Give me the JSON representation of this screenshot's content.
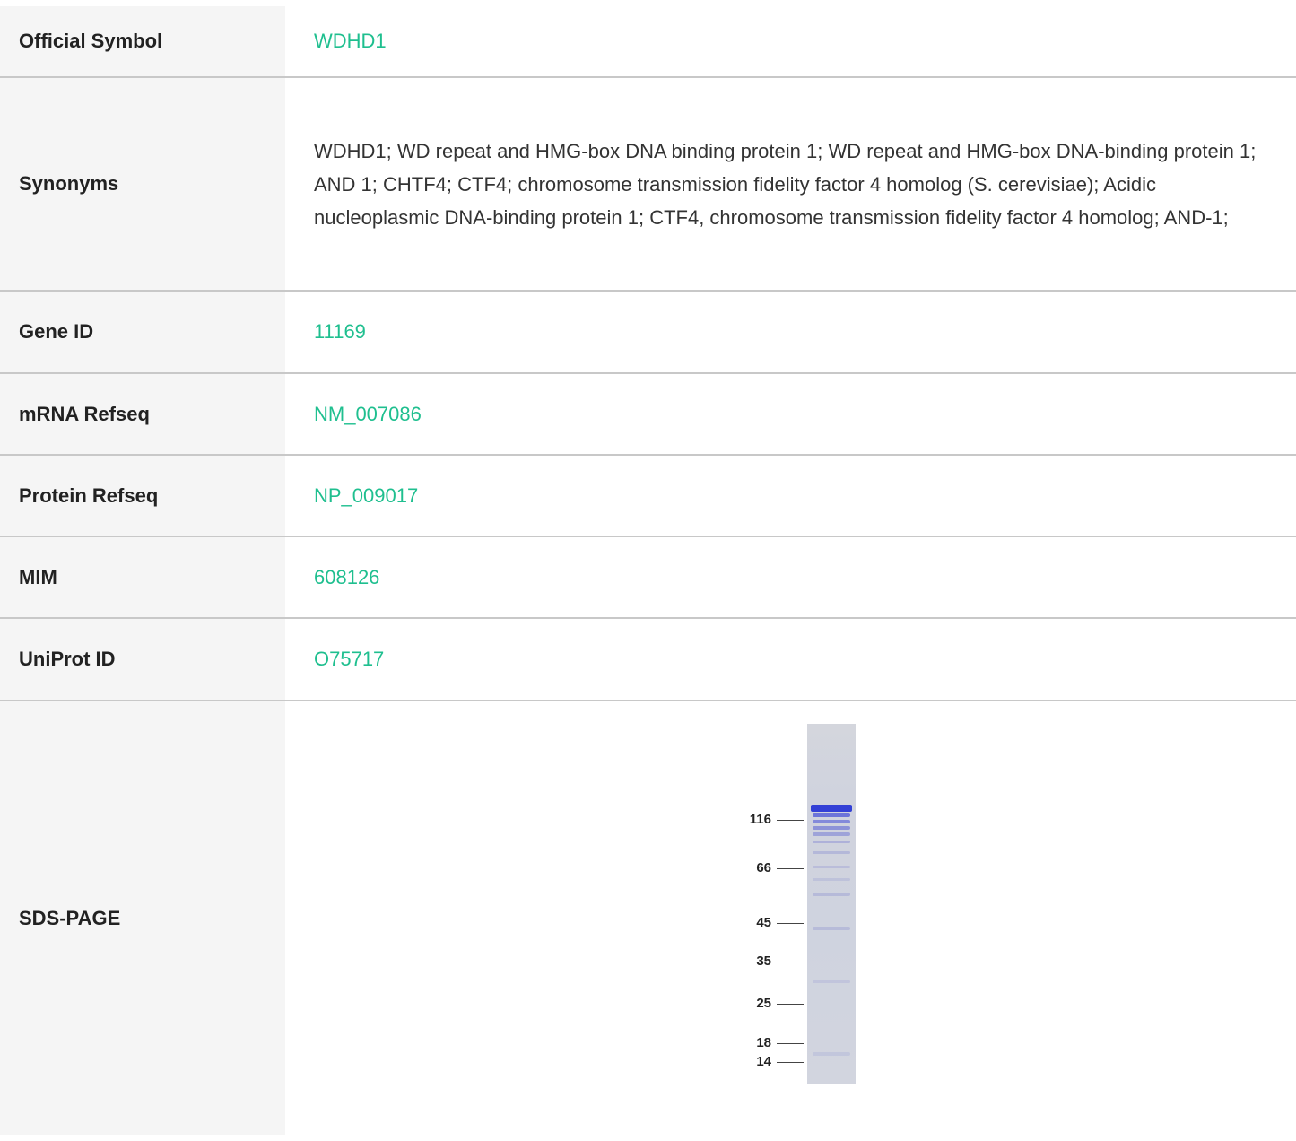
{
  "rows": {
    "official_symbol": {
      "label": "Official Symbol",
      "value": "WDHD1"
    },
    "synonyms": {
      "label": "Synonyms",
      "value": "WDHD1; WD repeat and HMG-box DNA binding protein 1; WD repeat and HMG-box DNA-binding protein 1; AND 1; CHTF4; CTF4; chromosome transmission fidelity factor 4 homolog (S. cerevisiae); Acidic nucleoplasmic DNA-binding protein 1; CTF4, chromosome transmission fidelity factor 4 homolog; AND-1;"
    },
    "gene_id": {
      "label": "Gene ID",
      "value": "11169"
    },
    "mrna_refseq": {
      "label": "mRNA Refseq",
      "value": "NM_007086"
    },
    "protein_refseq": {
      "label": "Protein Refseq",
      "value": "NP_009017"
    },
    "mim": {
      "label": "MIM",
      "value": "608126"
    },
    "uniprot_id": {
      "label": "UniProt ID",
      "value": "O75717"
    },
    "sds_page": {
      "label": "SDS-PAGE",
      "markers": [
        "116",
        "66",
        "45",
        "35",
        "25",
        "18",
        "14"
      ]
    }
  },
  "colors": {
    "link": "#1fbf8f",
    "label_bg": "#f5f5f5",
    "divider": "#c8c8c8",
    "gel_band": "#3a45d0"
  }
}
